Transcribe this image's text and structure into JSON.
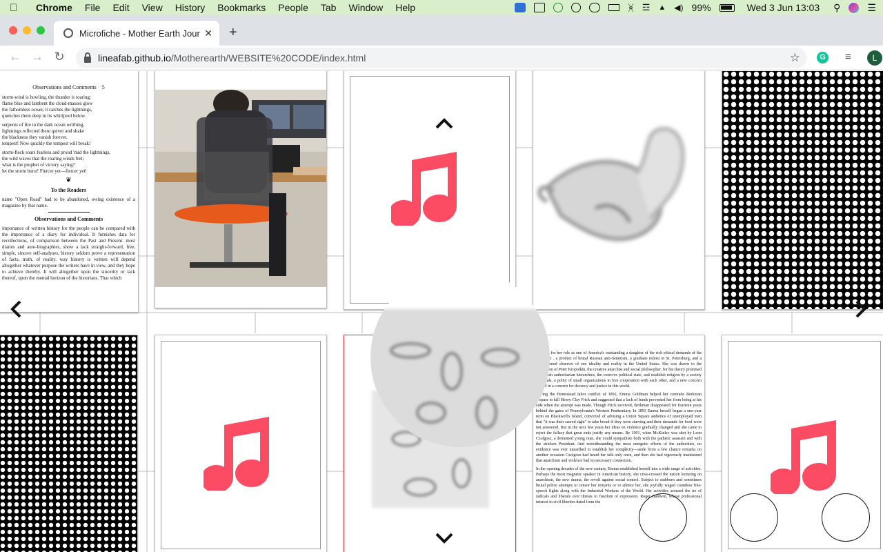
{
  "menubar": {
    "app_name": "Chrome",
    "items": [
      "File",
      "Edit",
      "View",
      "History",
      "Bookmarks",
      "People",
      "Tab",
      "Window",
      "Help"
    ],
    "battery": "99%",
    "clock": "Wed 3 Jun  13:03"
  },
  "browser": {
    "tab_title": "Microfiche - Mother Earth Jour",
    "url_host": "lineafab.github.io",
    "url_path": "/Motherearth/WEBSITE%20CODE/index.html",
    "profile_initial": "L",
    "ext_label": "G"
  },
  "page": {
    "nav_up": "⌃",
    "nav_down": "⌄",
    "nav_left": "‹",
    "nav_right": "›",
    "doc1": {
      "header": "Observations and Comments",
      "page_no": "5",
      "lines": [
        "storm-wind is howling, the thunder is roaring;",
        "flame blue and lambent the cloud-masses glow",
        "the fathomless ocean; it catches the lightnings,",
        "quenches them deep in its whirlpool below.",
        "serpents of fire in the dark ocean writhing,",
        "lightnings reflected there quiver and shake",
        "the blackness they vanish forever.",
        "tempest! Now quickly the tempest will break!",
        "storm-fleck soars fearless and proud 'mid the lightnings,",
        "the wild waves that the roaring winds fret;",
        "what is the prophet of victory saying?",
        "let the storm burst! Fiercer yet—fiercer yet!"
      ],
      "section1": "To the Readers",
      "section1_text": "name \"Open Road\" had to be abandoned, owing existence of a magazine by that name.",
      "section2": "Observations and Comments",
      "section2_text": "importance of written history for the people can be compared with the importance of a diary for individual. It furnishes data for recollections, of comparison between the Past and Present. most diaries and auto-biographies, show a lack straight-forward, free, simple, sincere self-analyses, history seldom prove a representation of facts, truth, of reality. way history is written will depend altogether whatever purpose the writers have in view, and they hope to achieve thereby. It will altogether upon the sincerity or lack thereof, upon the mental horizon of the historians. That which"
    },
    "doc2": {
      "para1": "tran and for her role as one of America's outstanding a daughter of the rich ethical demands of the prophetic , a product of brutal Russian anti-Semitism, a graduate milieu in St. Petersburg, and a disillusioned observer of een ideality and reality in the United States. She was drawn to the anarchism of Peter Kropotkin, the creative anarchist and social philosopher, for his theory promised to abolish authoritarian hierarchies, the coercive political state, and establish religion by a society of equals, a polity of small organizations in free cooperation with each other, and a new concern rooted in a concern for decency and justice in this world.",
      "para2": "During the Homestead labor conflict of 1892, Emma Goldman helped her comrade Berkman prepare to kill Henry Clay Frick and suggested that a lack of funds prevented her from being at his side when the attempt was made. Though Frick survived, Berkman disappeared for fourteen years behind the gates of Pennsylvania's Western Penitentiary. In 1893 Emma herself began a one-year term on Blackwell's Island, convicted of advising a Union Square audience of unemployed men that \"it was their sacred right\" to take bread if they were starving and their demands for food were not answered. But in the next few years her ideas on violence gradually changed and she came to reject the fallacy that great ends justify any means. By 1901, when McKinley was shot by Leon Czolgosz, a demented young man, she could sympathize both with the pathetic assassin and with the stricken President. And notwithstanding the most energetic efforts of the authorities, no evidence was ever unearthed to establish her complicity—aside from a few chance remarks on another occasion Czolgosz had heard her talk only once, and then she had vigorously maintained that anarchism and violence had no necessary connection.",
      "para3": "In the opening decades of the new century, Emma established herself into a wide range of activities. Perhaps the most magnetic speaker in American history, she criss-crossed the nation lecturing on anarchism, the new drama, the revolt against social control. Subject to stubborn and sometimes brutal police attempts to censor her remarks or to silence her, she joyfully waged countless free-speech fights along with the Industrial Workers of the World. Her activities aroused the ire of radicals and liberals over threats to freedom of expression. Roger Baldwin, whose professional interest in civil liberties dated from the"
    }
  },
  "colors": {
    "menubar_bg": "#d9efcb",
    "music_note": "#fc4c64",
    "active_card_border": "#d9333f"
  },
  "icons": {
    "music": "music-note-icon",
    "photo": "office-chair-photo",
    "fish": "fish-sculpture-image",
    "pattern": "halftone-pattern",
    "floral": "floral-blur-image"
  }
}
